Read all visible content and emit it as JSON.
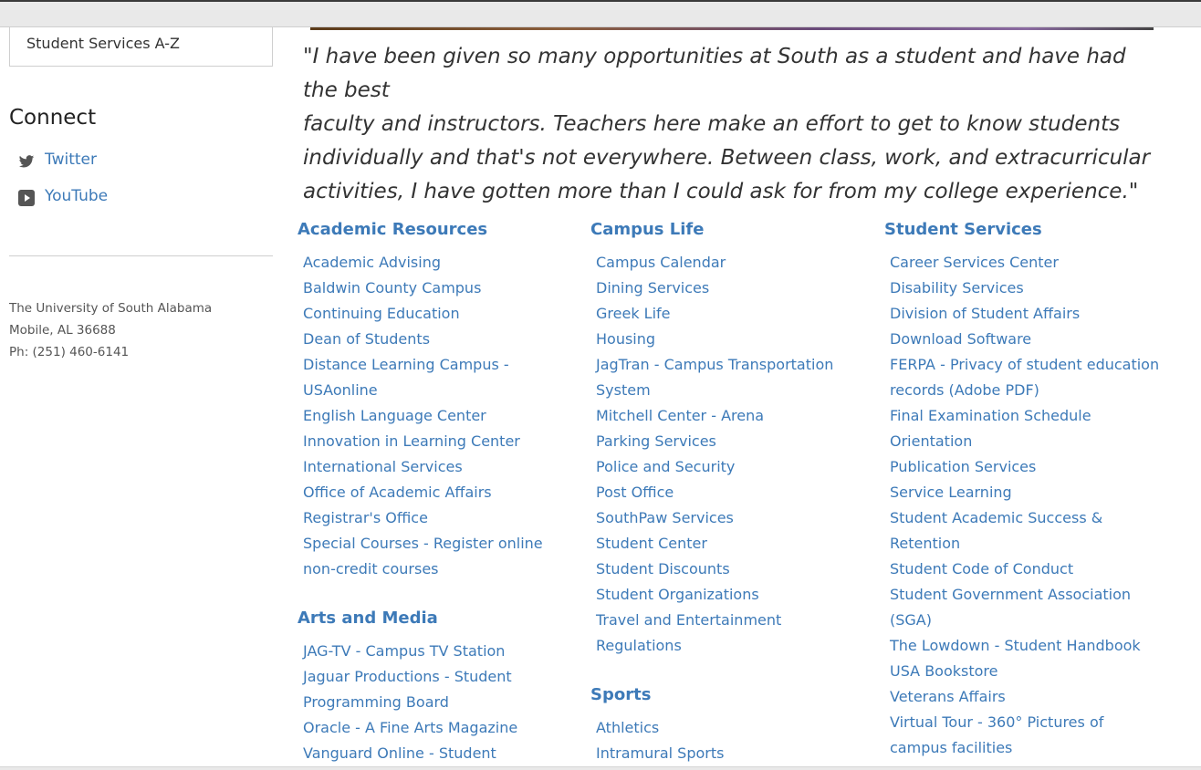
{
  "sidebar": {
    "top_link": "Student Services A-Z",
    "connect_heading": "Connect",
    "social": [
      {
        "label": "Twitter",
        "icon": "twitter-icon"
      },
      {
        "label": "YouTube",
        "icon": "youtube-icon"
      }
    ],
    "address": {
      "name": "The University of South Alabama",
      "city": "Mobile, AL 36688",
      "phone": "Ph: (251) 460-6141"
    }
  },
  "quote": "\"I have been given so many opportunities at South as a student and have had the best\nfaculty and instructors.  Teachers here make an effort to get to know students\nindividually and that's not everywhere. Between class, work, and extracurricular\nactivities, I have gotten more than I could ask for from my college experience.\"",
  "columns": [
    {
      "sections": [
        {
          "heading": "Academic Resources",
          "links": [
            "Academic Advising",
            "Baldwin County Campus",
            "Continuing Education",
            "Dean of Students",
            "Distance Learning Campus -\nUSAonline",
            "English Language Center",
            "Innovation in Learning Center",
            "International Services",
            "Office of Academic Affairs",
            "Registrar's Office",
            "Special Courses - Register online\nnon-credit courses"
          ]
        },
        {
          "heading": "Arts and Media",
          "links": [
            "JAG-TV - Campus TV Station",
            "Jaguar Productions - Student\nProgramming Board",
            "Oracle - A Fine Arts Magazine",
            "Vanguard Online - Student"
          ]
        }
      ]
    },
    {
      "sections": [
        {
          "heading": "Campus Life",
          "links": [
            "Campus Calendar",
            "Dining Services",
            "Greek Life",
            "Housing",
            "JagTran - Campus Transportation\nSystem",
            "Mitchell Center - Arena",
            "Parking Services",
            "Police and Security",
            "Post Office",
            "SouthPaw Services",
            "Student Center",
            "Student Discounts",
            "Student Organizations",
            "Travel and Entertainment\nRegulations"
          ]
        },
        {
          "heading": "Sports",
          "links": [
            "Athletics",
            "Intramural Sports"
          ]
        }
      ]
    },
    {
      "sections": [
        {
          "heading": "Student Services",
          "links": [
            "Career Services Center",
            "Disability Services",
            "Division of Student Affairs",
            "Download Software",
            "FERPA - Privacy of student education\nrecords (Adobe PDF)",
            "Final Examination Schedule",
            "Orientation",
            "Publication Services",
            "Service Learning",
            "Student Academic Success &\nRetention",
            "Student Code of Conduct",
            "Student Government Association\n(SGA)",
            "The Lowdown - Student Handbook",
            "USA Bookstore",
            "Veterans Affairs",
            "Virtual Tour - 360° Pictures of\ncampus facilities"
          ]
        }
      ]
    }
  ],
  "colors": {
    "link": "#3d7ab8",
    "text": "#333333",
    "muted": "#555555"
  }
}
